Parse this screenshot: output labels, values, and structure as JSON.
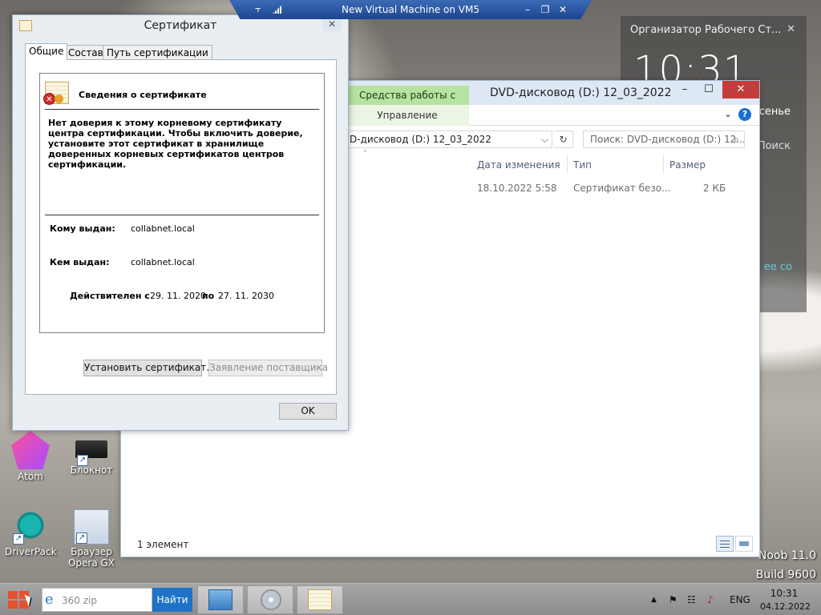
{
  "vm_bar": {
    "title": "New Virtual Machine on VM5",
    "pin_icon": "pin-icon",
    "signal_icon": "signal-icon",
    "minimize_glyph": "–",
    "restore_glyph": "❐",
    "close_glyph": "✕"
  },
  "organizer": {
    "title": "Организатор Рабочего Ст...",
    "close_glyph": "✕",
    "clock": "10:31",
    "side_text_1": "сенье",
    "side_text_2": "Поиск",
    "side_text_3": "е ее со"
  },
  "desktop": {
    "icons": [
      {
        "label": "Atom"
      },
      {
        "label": "Блокнот"
      },
      {
        "label": "DriverPack"
      },
      {
        "label": "Браузер Opera GX"
      }
    ],
    "shortcut_glyph": "↗",
    "build_line_1": "Noob 11.0",
    "build_line_2": "Build 9600"
  },
  "explorer": {
    "ribbon_context_label": "Средства работы с дисками",
    "title": "DVD-дисковод (D:) 12_03_2022",
    "manage_tab": "Управление",
    "chevron_glyph": "⌄",
    "help_glyph": "?",
    "address": "D-дисковод (D:) 12_03_2022",
    "dropdown_glyph": "⌵",
    "refresh_glyph": "↻",
    "search_placeholder": "Поиск: DVD-дисковод (D:) 12...",
    "search_glyph": "⌕",
    "sort_glyph": "˄",
    "columns": [
      "Дата изменения",
      "Тип",
      "Размер"
    ],
    "rows": [
      {
        "date": "18.10.2022 5:58",
        "type": "Сертификат безо...",
        "size": "2 КБ"
      }
    ],
    "status": "1 элемент",
    "minimize_glyph": "–",
    "maximize_glyph": "☐",
    "close_glyph": "✕"
  },
  "certificate": {
    "title": "Сертификат",
    "close_glyph": "✕",
    "tabs": [
      "Общие",
      "Состав",
      "Путь сертификации"
    ],
    "heading": "Сведения о сертификате",
    "warning": "Нет доверия к этому корневому сертификату центра сертификации. Чтобы включить  доверие, установите этот сертификат в хранилище доверенных корневых сертификатов центров сертификации.",
    "issued_to_label": "Кому выдан:",
    "issued_to": "collabnet.local",
    "issued_by_label": "Кем выдан:",
    "issued_by": "collabnet.local",
    "valid_from_label": "Действителен с",
    "valid_from": "29. 11. 2020",
    "valid_to_label": "по",
    "valid_to": "27. 11. 2030",
    "install_button": "Установить сертификат...",
    "issuer_statement_button": "Заявление поставщика",
    "ok_button": "OK",
    "error_glyph": "✕"
  },
  "taskbar": {
    "search_value": "360 zip",
    "ie_glyph": "e",
    "search_button": "Найти",
    "tray_arrow": "▲",
    "tray_flag": "⚑",
    "tray_network": "☷",
    "tray_volume": "♪",
    "language": "ENG",
    "time": "10:31",
    "date": "04.12.2022"
  }
}
